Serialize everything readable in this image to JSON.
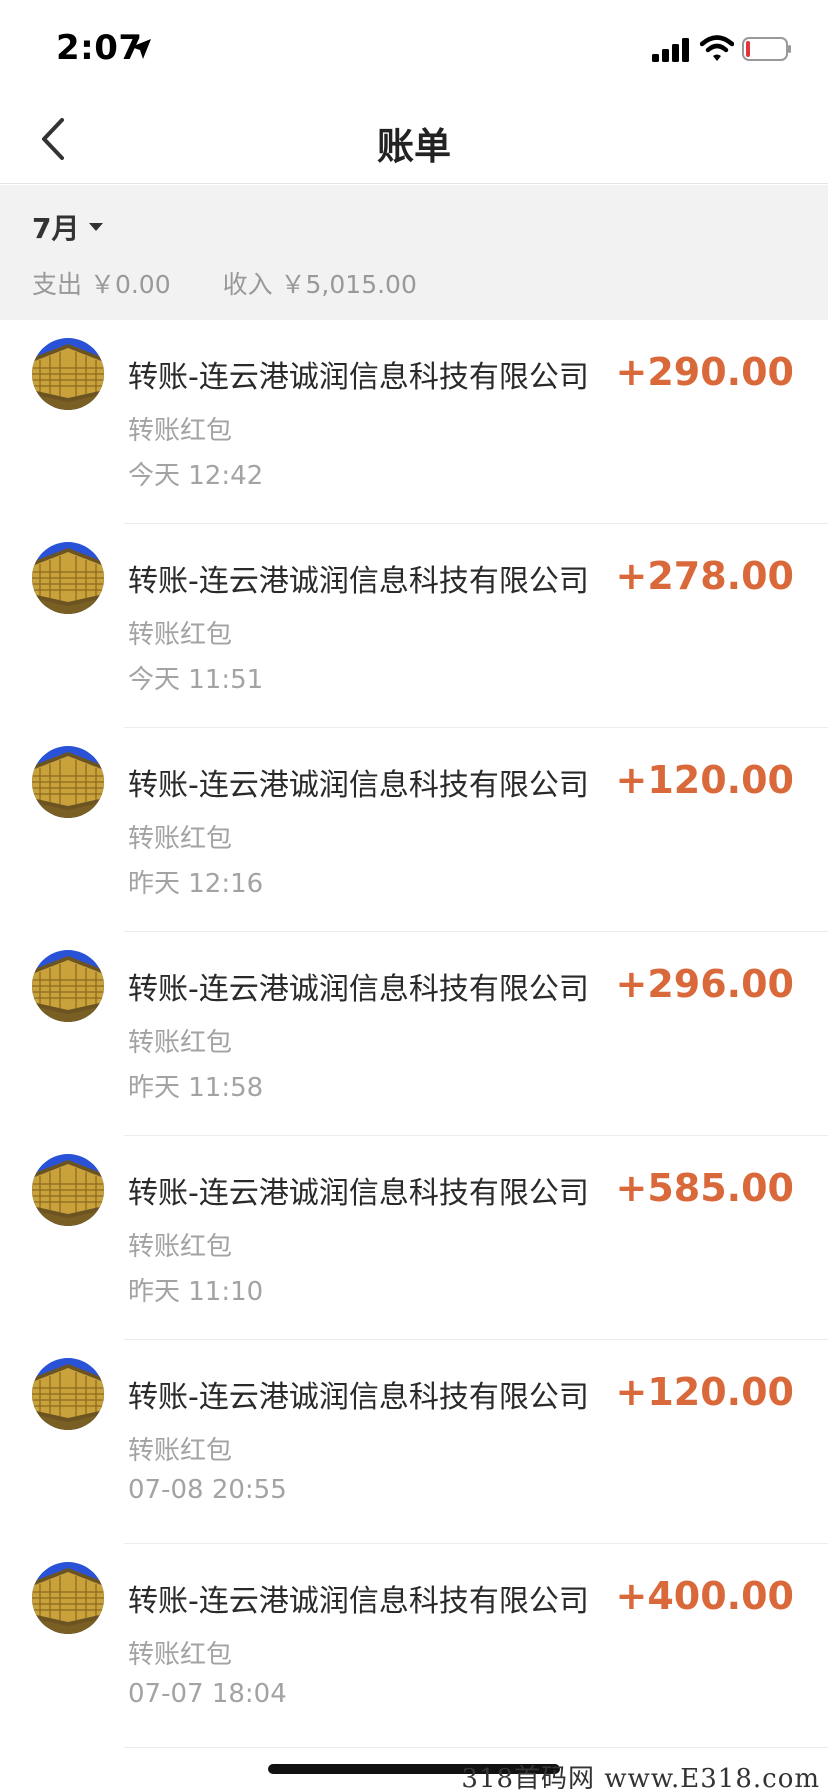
{
  "status_bar": {
    "time": "2:07",
    "icons": [
      "location-arrow-icon",
      "cellular-signal-icon",
      "wifi-icon",
      "battery-icon"
    ]
  },
  "nav": {
    "back_icon": "chevron-left-icon",
    "title": "账单"
  },
  "summary": {
    "month": "7月",
    "expense": "支出 ￥0.00",
    "income": "收入 ￥5,015.00"
  },
  "colors": {
    "accent_amount": "#d9693a",
    "summary_bg": "#f2f2f2",
    "secondary_text": "#a3a3a3"
  },
  "transactions": [
    {
      "title": "转账-连云港诚润信息科技有限公司",
      "subtitle": "转账红包",
      "time": "今天  12:42",
      "amount": "+290.00"
    },
    {
      "title": "转账-连云港诚润信息科技有限公司",
      "subtitle": "转账红包",
      "time": "今天  11:51",
      "amount": "+278.00"
    },
    {
      "title": "转账-连云港诚润信息科技有限公司",
      "subtitle": "转账红包",
      "time": "昨天  12:16",
      "amount": "+120.00"
    },
    {
      "title": "转账-连云港诚润信息科技有限公司",
      "subtitle": "转账红包",
      "time": "昨天  11:58",
      "amount": "+296.00"
    },
    {
      "title": "转账-连云港诚润信息科技有限公司",
      "subtitle": "转账红包",
      "time": "昨天  11:10",
      "amount": "+585.00"
    },
    {
      "title": "转账-连云港诚润信息科技有限公司",
      "subtitle": "转账红包",
      "time": "07-08  20:55",
      "amount": "+120.00"
    },
    {
      "title": "转账-连云港诚润信息科技有限公司",
      "subtitle": "转账红包",
      "time": "07-07  18:04",
      "amount": "+400.00"
    }
  ],
  "watermark": "318首码网 www.E318.com"
}
